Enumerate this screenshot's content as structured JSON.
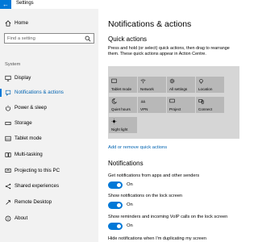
{
  "window": {
    "title": "Settings",
    "back_glyph": "←"
  },
  "sidebar": {
    "home_label": "Home",
    "search_placeholder": "Find a setting",
    "section_label": "System",
    "items": [
      {
        "label": "Display",
        "icon": "display-icon"
      },
      {
        "label": "Notifications & actions",
        "icon": "notifications-icon",
        "active": true
      },
      {
        "label": "Power & sleep",
        "icon": "power-icon"
      },
      {
        "label": "Storage",
        "icon": "storage-icon"
      },
      {
        "label": "Tablet mode",
        "icon": "tablet-mode-icon"
      },
      {
        "label": "Multi-tasking",
        "icon": "multitasking-icon"
      },
      {
        "label": "Projecting to this PC",
        "icon": "projecting-icon"
      },
      {
        "label": "Shared experiences",
        "icon": "shared-experiences-icon"
      },
      {
        "label": "Remote Desktop",
        "icon": "remote-desktop-icon"
      },
      {
        "label": "About",
        "icon": "about-icon"
      }
    ]
  },
  "main": {
    "page_title": "Notifications & actions",
    "quick_actions": {
      "heading": "Quick actions",
      "description": "Press and hold (or select) quick actions, then drag to rearrange them. These quick actions appear in Action Centre.",
      "tiles": [
        {
          "label": "Tablet mode",
          "icon": "tablet-mode-icon"
        },
        {
          "label": "Network",
          "icon": "network-icon"
        },
        {
          "label": "All settings",
          "icon": "settings-icon"
        },
        {
          "label": "Location",
          "icon": "location-icon"
        },
        {
          "label": "Quiet hours",
          "icon": "moon-icon"
        },
        {
          "label": "VPN",
          "icon": "vpn-icon"
        },
        {
          "label": "Project",
          "icon": "project-icon"
        },
        {
          "label": "Connect",
          "icon": "connect-icon"
        },
        {
          "label": "Night light",
          "icon": "night-light-icon"
        }
      ],
      "add_remove_link": "Add or remove quick actions"
    },
    "notifications": {
      "heading": "Notifications",
      "options": [
        {
          "label": "Get notifications from apps and other senders",
          "state": "On"
        },
        {
          "label": "Show notifications on the lock screen",
          "state": "On"
        },
        {
          "label": "Show reminders and incoming VoIP calls on the lock screen",
          "state": "On"
        },
        {
          "label": "Hide notifications when I'm duplicating my screen"
        }
      ]
    }
  },
  "colors": {
    "accent": "#0078d7",
    "sidebar_bg": "#f2f2f2",
    "tile_bg": "#b8b8b8",
    "grid_bg": "#d6d6d6"
  }
}
